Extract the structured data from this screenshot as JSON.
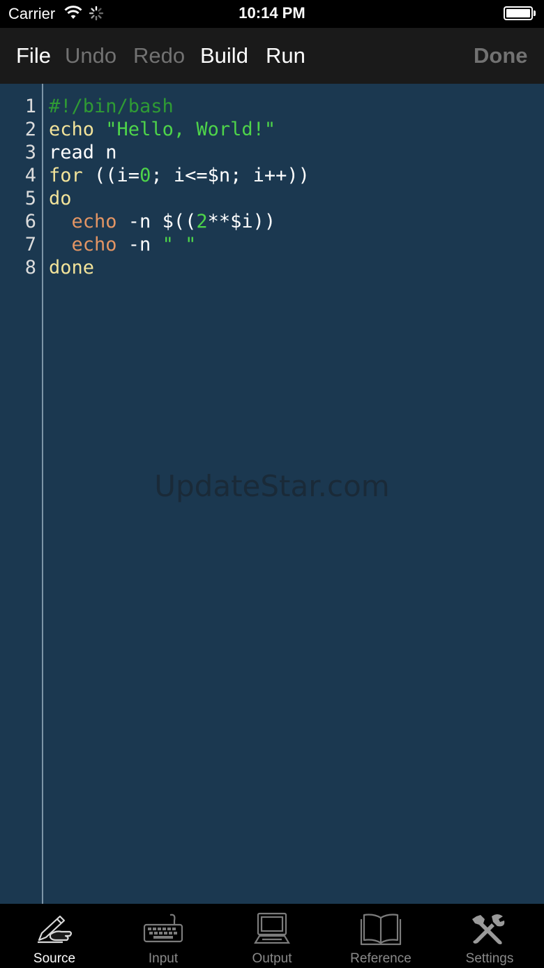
{
  "status": {
    "carrier": "Carrier",
    "time": "10:14 PM"
  },
  "toolbar": {
    "file": "File",
    "undo": "Undo",
    "redo": "Redo",
    "build": "Build",
    "run": "Run",
    "done": "Done"
  },
  "editor": {
    "line_numbers": [
      "1",
      "2",
      "3",
      "4",
      "5",
      "6",
      "7",
      "8"
    ],
    "lines": [
      [
        {
          "t": "#!/bin/bash",
          "c": "comment"
        }
      ],
      [
        {
          "t": "echo",
          "c": "keyword"
        },
        {
          "t": " ",
          "c": "plain"
        },
        {
          "t": "\"Hello, World!\"",
          "c": "string"
        }
      ],
      [
        {
          "t": "read n",
          "c": "plain"
        }
      ],
      [
        {
          "t": "for",
          "c": "keyword"
        },
        {
          "t": " ((i=",
          "c": "plain"
        },
        {
          "t": "0",
          "c": "number"
        },
        {
          "t": "; i<=$n; i++))",
          "c": "plain"
        }
      ],
      [
        {
          "t": "do",
          "c": "keyword"
        }
      ],
      [
        {
          "t": "  ",
          "c": "plain"
        },
        {
          "t": "echo",
          "c": "builtin"
        },
        {
          "t": " -n $((",
          "c": "plain"
        },
        {
          "t": "2",
          "c": "number"
        },
        {
          "t": "**$i))",
          "c": "plain"
        }
      ],
      [
        {
          "t": "  ",
          "c": "plain"
        },
        {
          "t": "echo",
          "c": "builtin"
        },
        {
          "t": " -n ",
          "c": "plain"
        },
        {
          "t": "\" \"",
          "c": "string"
        }
      ],
      [
        {
          "t": "done",
          "c": "keyword"
        }
      ]
    ],
    "watermark": "UpdateStar.com"
  },
  "tabs": [
    {
      "label": "Source",
      "icon": "pen-hand-icon",
      "active": true
    },
    {
      "label": "Input",
      "icon": "keyboard-icon",
      "active": false
    },
    {
      "label": "Output",
      "icon": "computer-monitor-icon",
      "active": false
    },
    {
      "label": "Reference",
      "icon": "open-book-icon",
      "active": false
    },
    {
      "label": "Settings",
      "icon": "tools-icon",
      "active": false
    }
  ],
  "colors": {
    "editor_bg": "#1b3850",
    "comment": "#2f9b34",
    "keyword": "#f2e39a",
    "builtin": "#e39564",
    "string": "#4ed44a"
  }
}
